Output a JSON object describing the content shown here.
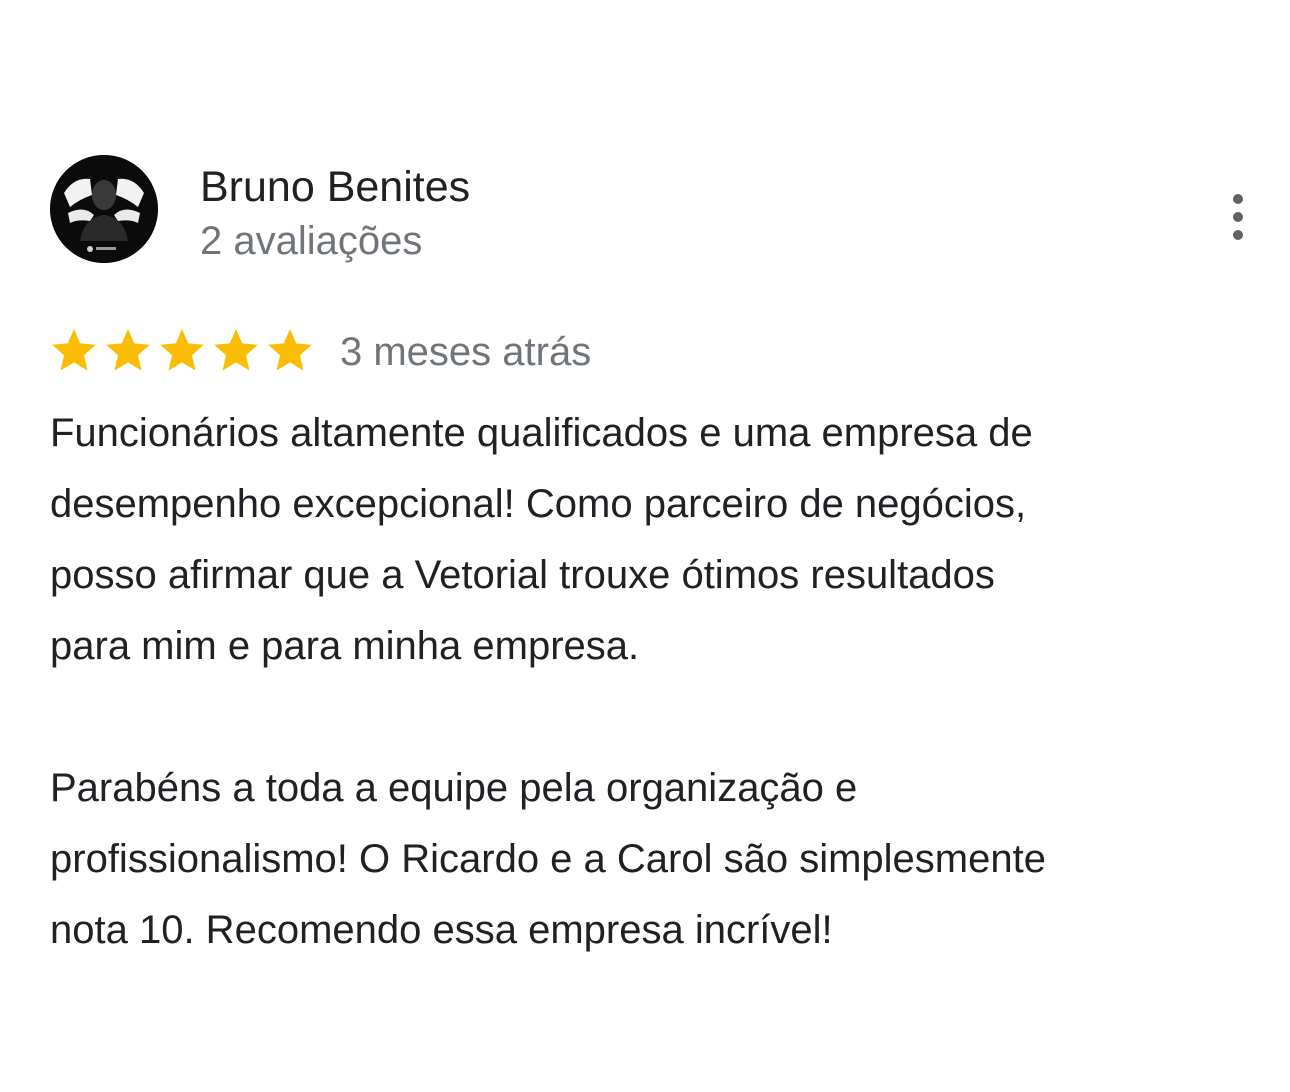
{
  "review": {
    "author": {
      "name": "Bruno Benites",
      "meta": "2 avaliações",
      "avatar_icon": "profile-photo-avatar"
    },
    "menu_icon": "more-vert-icon",
    "rating": {
      "stars": 5,
      "max": 5,
      "star_color": "#fbbc04"
    },
    "date": "3 meses atrás",
    "paragraphs": [
      "Funcionários altamente qualificados e uma empresa de\ndesempenho excepcional! Como parceiro de negócios,\nposso afirmar que a Vetorial trouxe ótimos resultados\npara mim e para minha empresa.",
      "Parabéns a toda a equipe pela organização e\nprofissionalismo! O Ricardo e a Carol são simplesmente\nnota 10. Recomendo essa empresa incrível!"
    ]
  }
}
